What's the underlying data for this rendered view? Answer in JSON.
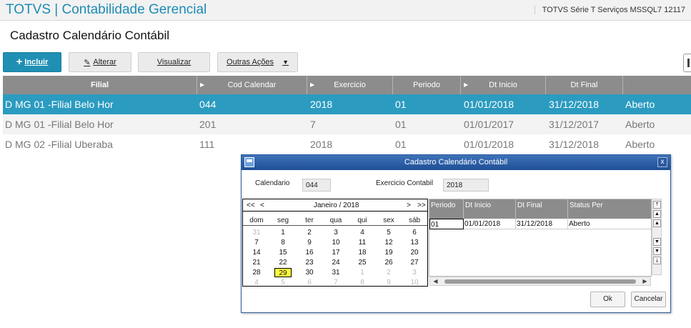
{
  "header": {
    "app_title": "TOTVS | Contabilidade Gerencial",
    "server_info": "TOTVS Série T Serviços MSSQL7 12117"
  },
  "page_title": "Cadastro Calendário Contábil",
  "toolbar": {
    "incluir": "Incluir",
    "alterar": "Alterar",
    "visualizar": "Visualizar",
    "outras_acoes": "Outras Ações"
  },
  "grid": {
    "columns": [
      "Filial",
      "Cod Calendar",
      "Exercicio",
      "Periodo",
      "Dt Inicio",
      "Dt Final",
      ""
    ],
    "rows": [
      [
        "D MG 01 -Filial Belo Hor",
        "044",
        "2018",
        "01",
        "01/01/2018",
        "31/12/2018",
        "Aberto"
      ],
      [
        "D MG 01 -Filial Belo Hor",
        "201",
        "7",
        "01",
        "01/01/2017",
        "31/12/2017",
        "Aberto"
      ],
      [
        "D MG 02 -Filial Uberaba",
        "111",
        "2018",
        "01",
        "01/01/2018",
        "31/12/2018",
        "Aberto"
      ]
    ]
  },
  "dialog": {
    "title": "Cadastro Calendário Contábil",
    "close": "x",
    "calendario_label": "Calendario",
    "calendario_value": "044",
    "exercicio_label": "Exercicio Contabil",
    "exercicio_value": "2018",
    "calendar": {
      "nav_prev_year": "<<",
      "nav_prev_month": "<",
      "month_label": "Janeiro / 2018",
      "nav_next_month": ">",
      "nav_next_year": ">>",
      "weekdays": [
        "dom",
        "seg",
        "ter",
        "qua",
        "qui",
        "sex",
        "sáb"
      ],
      "weeks": [
        [
          "31",
          "1",
          "2",
          "3",
          "4",
          "5",
          "6"
        ],
        [
          "7",
          "8",
          "9",
          "10",
          "11",
          "12",
          "13"
        ],
        [
          "14",
          "15",
          "16",
          "17",
          "18",
          "19",
          "20"
        ],
        [
          "21",
          "22",
          "23",
          "24",
          "25",
          "26",
          "27"
        ],
        [
          "28",
          "29",
          "30",
          "31",
          "1",
          "2",
          "3"
        ],
        [
          "4",
          "5",
          "6",
          "7",
          "8",
          "9",
          "10"
        ]
      ],
      "selected_day": "29"
    },
    "periods": {
      "columns": [
        "Periodo",
        "Dt Inicio",
        "Dt Final",
        "Status Per"
      ],
      "rows": [
        [
          "01",
          "01/01/2018",
          "31/12/2018",
          "Aberto"
        ]
      ]
    },
    "ok": "Ok",
    "cancel": "Cancelar"
  },
  "colors": {
    "brand": "#1e8cb5",
    "selected_row": "#2b9bc0",
    "grid_header": "#8c8c8c",
    "dialog_title": "#1e4f96",
    "today_highlight": "#ffff3c"
  }
}
